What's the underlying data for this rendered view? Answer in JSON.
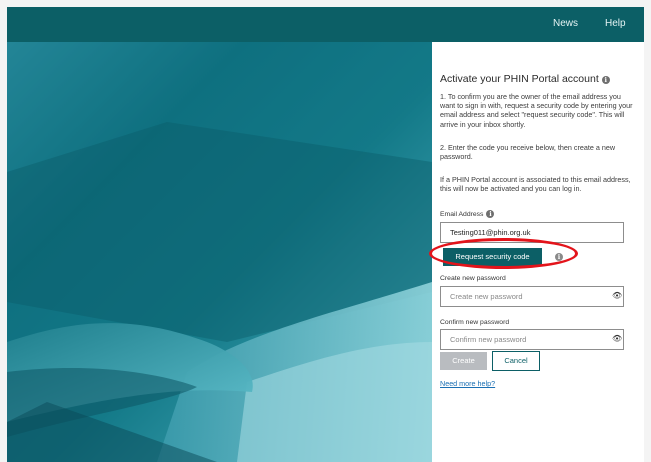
{
  "nav": {
    "news": "News",
    "help": "Help"
  },
  "panel": {
    "title": "Activate your PHIN Portal account",
    "p1": "1. To confirm you are the owner of the email address you want to sign in with, request a security code by entering your email address and select \"request security code\". This will arrive in your inbox shortly.",
    "p2": "2. Enter the code you receive below, then create a new password.",
    "p3": "If a PHIN Portal account is associated to this email address, this will now be activated and you can log in.",
    "email_label": "Email Address",
    "email_value": "Testing011@phin.org.uk",
    "request_label": "Request security code",
    "new_label": "Create new password",
    "new_placeholder": "Create new password",
    "confirm_label": "Confirm new password",
    "confirm_placeholder": "Confirm new password",
    "create_label": "Create",
    "cancel_label": "Cancel",
    "help_link": "Need more help?"
  },
  "icons": {
    "info": "info-circle-icon",
    "eye": "eye-icon",
    "annotation": "red-ellipse-highlight"
  },
  "colors": {
    "brand": "#0c5f66",
    "disabled": "#b9bcc0",
    "link": "#1a6fb3",
    "highlight": "#e3141b"
  }
}
